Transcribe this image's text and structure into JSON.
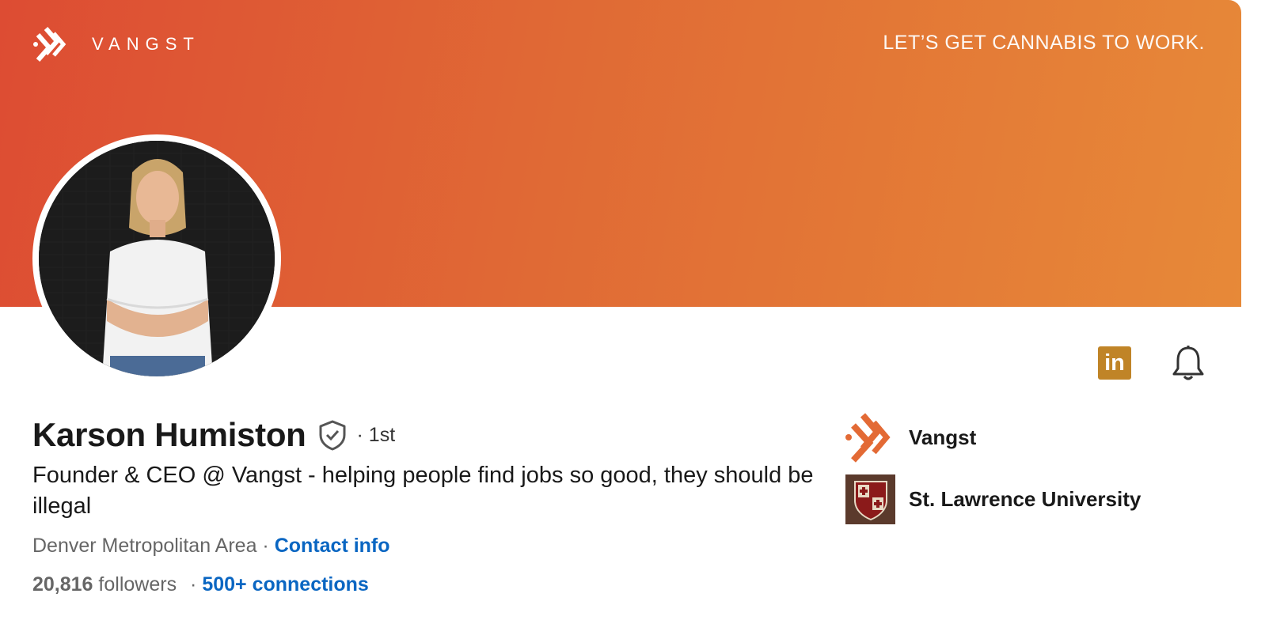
{
  "banner": {
    "brand": "VANGST",
    "tagline": "LET’S GET CANNABIS TO WORK.",
    "colors": {
      "start": "#dd4c33",
      "end": "#e78938"
    }
  },
  "profile": {
    "name": "Karson Humiston",
    "degree": "· 1st",
    "headline": "Founder & CEO @ Vangst - helping people find jobs so good, they should be illegal",
    "location": "Denver Metropolitan Area ·",
    "contact_label": "Contact info",
    "followers_count": "20,816",
    "followers_label": "followers",
    "separator": "·",
    "connections_label": "500+ connections"
  },
  "actions": {
    "linkedin_label": "in",
    "icons": [
      "linkedin-icon",
      "bell-icon"
    ]
  },
  "organizations": [
    {
      "name": "Vangst",
      "icon": "vangst-logo"
    },
    {
      "name": "St. Lawrence University",
      "icon": "university-crest"
    }
  ],
  "colors": {
    "link": "#0a66c2",
    "linkedin_badge": "#c08427",
    "accent": "#e36a35"
  }
}
